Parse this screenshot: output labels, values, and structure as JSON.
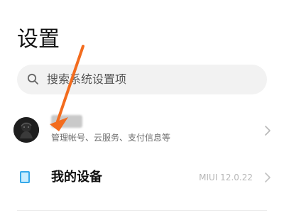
{
  "page": {
    "title": "设置"
  },
  "search": {
    "placeholder": "搜索系统设置项"
  },
  "account": {
    "subtitle": "管理帐号、云服务、支付信息等"
  },
  "device": {
    "label": "我的设备",
    "version": "MIUI 12.0.22"
  },
  "icons": {
    "search": "search-icon",
    "avatar": "avatar",
    "chevron": "chevron-right-icon",
    "device": "device-icon",
    "annotation": "arrow-icon"
  },
  "colors": {
    "background": "#ffffff",
    "search_background": "#f2f2f2",
    "annotation_arrow": "#f36c1e",
    "device_icon": "#36a9ea"
  }
}
